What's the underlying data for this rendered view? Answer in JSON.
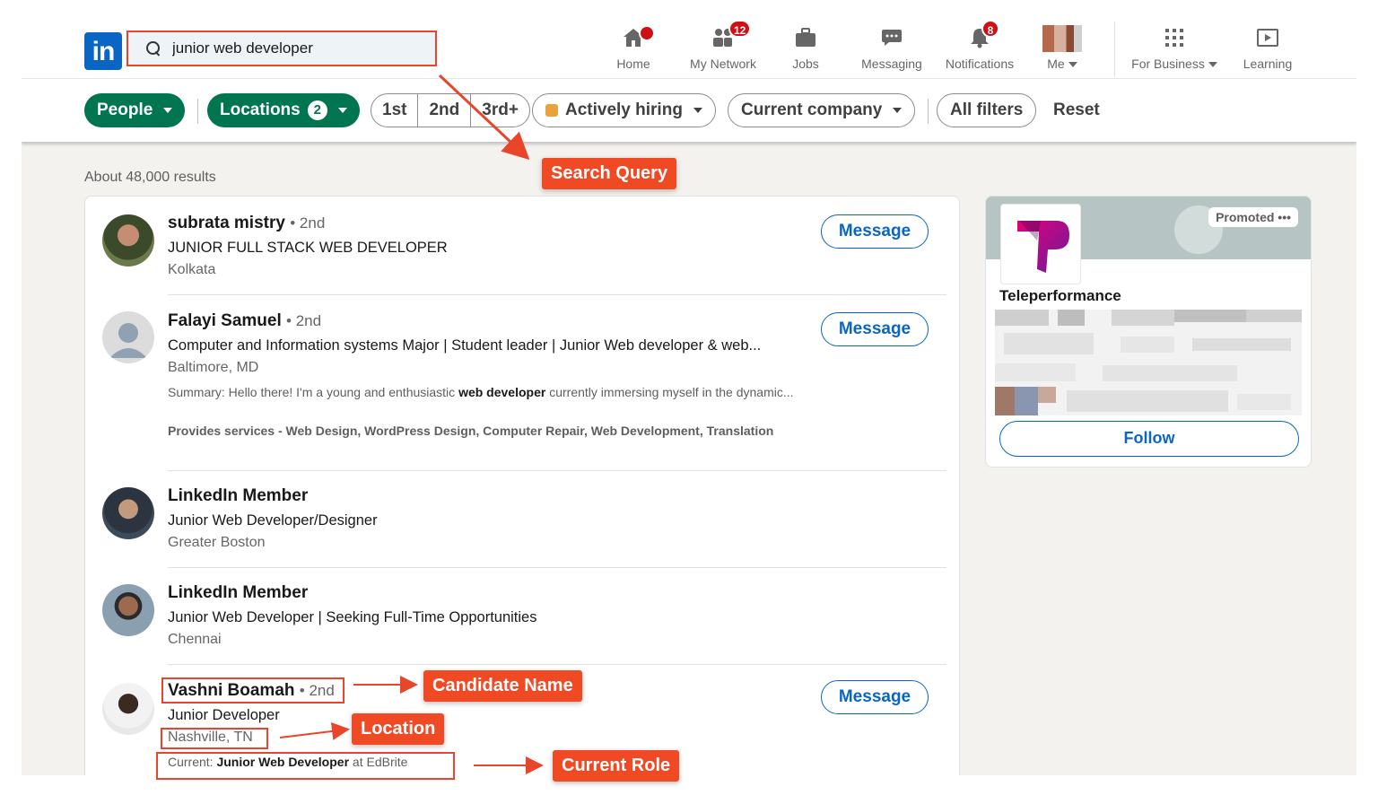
{
  "nav": {
    "logo": "in",
    "search_value": "junior web developer",
    "items": [
      {
        "label": "Home",
        "icon": "home-icon",
        "badge": ""
      },
      {
        "label": "My Network",
        "icon": "people-icon",
        "badge": "12"
      },
      {
        "label": "Jobs",
        "icon": "briefcase-icon",
        "badge": ""
      },
      {
        "label": "Messaging",
        "icon": "chat-icon",
        "badge": ""
      },
      {
        "label": "Notifications",
        "icon": "bell-icon",
        "badge": "8"
      },
      {
        "label": "Me",
        "icon": "avatar",
        "badge": ""
      },
      {
        "label": "For Business",
        "icon": "grid-icon",
        "badge": ""
      },
      {
        "label": "Learning",
        "icon": "learning-icon",
        "badge": ""
      }
    ]
  },
  "filters": {
    "people": "People",
    "locations": "Locations",
    "locations_count": "2",
    "degrees": [
      "1st",
      "2nd",
      "3rd+"
    ],
    "actively_hiring": "Actively hiring",
    "current_company": "Current company",
    "all_filters": "All filters",
    "reset": "Reset"
  },
  "results_count": "About 48,000 results",
  "results": [
    {
      "name": "subrata mistry",
      "degree": "• 2nd",
      "headline": "JUNIOR FULL STACK WEB DEVELOPER",
      "location": "Kolkata",
      "action": "Message"
    },
    {
      "name": "Falayi Samuel",
      "degree": "• 2nd",
      "headline": "Computer and Information systems Major | Student leader | Junior Web developer & web...",
      "location": "Baltimore, MD",
      "summary_pre": "Summary: Hello there! I'm a young and enthusiastic ",
      "summary_bold": "web developer",
      "summary_post": " currently immersing myself in the dynamic...",
      "services": "Provides services - Web Design, WordPress Design, Computer Repair, Web Development, Translation",
      "action": "Message"
    },
    {
      "name": "LinkedIn Member",
      "degree": "",
      "headline": "Junior Web Developer/Designer",
      "location": "Greater Boston",
      "action": ""
    },
    {
      "name": "LinkedIn Member",
      "degree": "",
      "headline": "Junior Web Developer | Seeking Full-Time Opportunities",
      "location": "Chennai",
      "action": ""
    },
    {
      "name": "Vashni Boamah",
      "degree": "• 2nd",
      "headline": "Junior Developer",
      "location": "Nashville, TN",
      "current_pre": "Current: ",
      "current_role": "Junior Web Developer",
      "current_post": " at EdBrite",
      "action": "Message"
    }
  ],
  "ad": {
    "promoted": "Promoted •••",
    "company": "Teleperformance",
    "follow": "Follow"
  },
  "annotations": {
    "search_query": "Search Query",
    "candidate_name": "Candidate Name",
    "location": "Location",
    "current_role": "Current Role"
  },
  "colors": {
    "linkedin_blue": "#0a66c2",
    "filter_green": "#01754f",
    "annotation_orange": "#f04a24",
    "notification_red": "#cc1016"
  }
}
